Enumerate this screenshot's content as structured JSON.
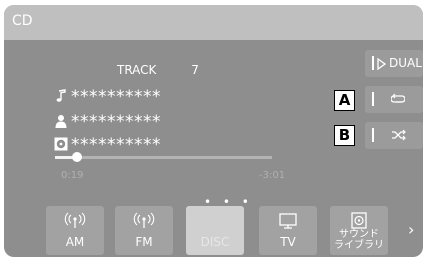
{
  "header": {
    "title": "CD"
  },
  "track": {
    "label": "TRACK",
    "number": "7"
  },
  "meta": {
    "title": "**********",
    "artist": "**********",
    "album": "**********",
    "title_icon": "music-note-icon",
    "artist_icon": "person-icon",
    "album_icon": "disc-icon"
  },
  "progress": {
    "elapsed": "0:19",
    "remaining": "-3:01",
    "fraction": 0.1
  },
  "side_buttons": {
    "dual_label": "DUAL",
    "repeat_icon": "repeat-icon",
    "shuffle_icon": "shuffle-icon"
  },
  "callouts": {
    "a": "A",
    "b": "B"
  },
  "pager": {
    "dots": "• • •"
  },
  "sources": [
    {
      "label": "AM",
      "icon": "radio-antenna-icon"
    },
    {
      "label": "FM",
      "icon": "radio-antenna-icon"
    },
    {
      "label": "DISC",
      "icon": "disc-icon"
    },
    {
      "label": "TV",
      "icon": "tv-icon"
    },
    {
      "label": "サウンド\nライブラリ",
      "icon": "sound-library-icon"
    }
  ],
  "colors": {
    "screen": "#8e8e8e",
    "title_bar": "#bfbfbf",
    "button": "#a2a2a2",
    "active_button": "#d0d0d0"
  }
}
